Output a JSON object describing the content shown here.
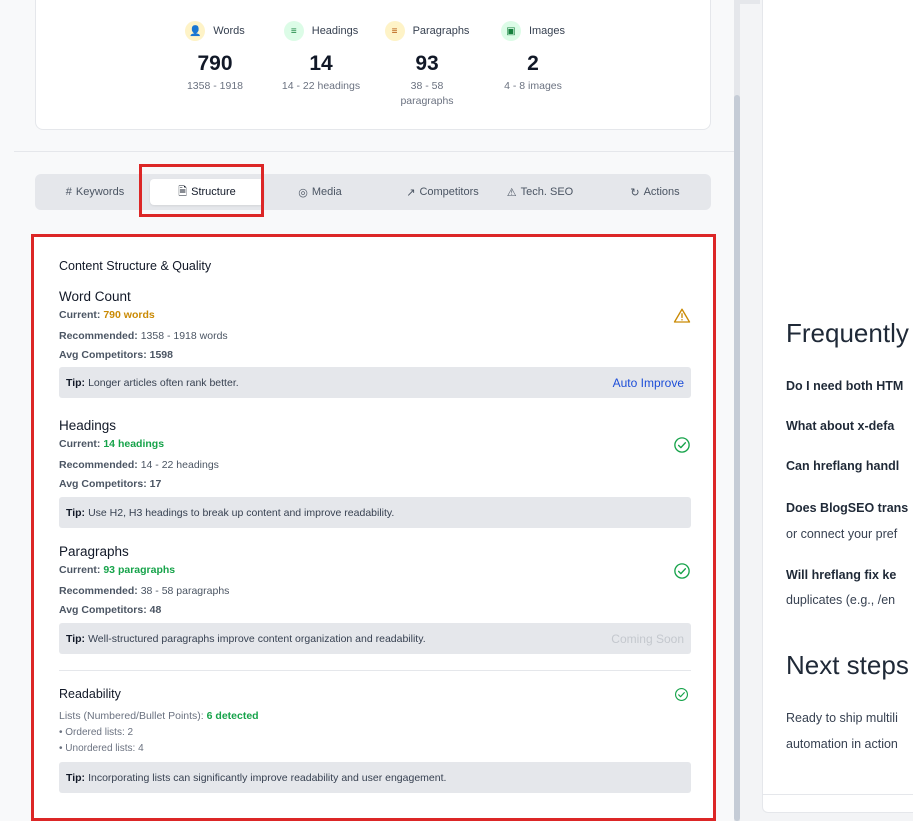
{
  "stats": [
    {
      "label": "Words",
      "value": "790",
      "range": "1358 - 1918",
      "icon": "person-icon"
    },
    {
      "label": "Headings",
      "value": "14",
      "range": "14 - 22 headings",
      "icon": "list-icon"
    },
    {
      "label": "Paragraphs",
      "value": "93",
      "range": "38 - 58 paragraphs",
      "icon": "paragraph-icon"
    },
    {
      "label": "Images",
      "value": "2",
      "range": "4 - 8 images",
      "icon": "image-icon"
    }
  ],
  "tabs": [
    {
      "label": "Keywords",
      "glyph": "#"
    },
    {
      "label": "Structure",
      "glyph": "🗎"
    },
    {
      "label": "Media",
      "glyph": "◎"
    },
    {
      "label": "Competitors",
      "glyph": "↗"
    },
    {
      "label": "Tech. SEO",
      "glyph": "⚠"
    },
    {
      "label": "Actions",
      "glyph": "↻"
    }
  ],
  "section_title": "Content Structure & Quality",
  "word_count": {
    "title": "Word Count",
    "current_label": "Current:",
    "current_value": "790 words",
    "recommended_label": "Recommended:",
    "recommended_value": "1358 - 1918 words",
    "avg_label": "Avg Competitors:",
    "avg_value": "1598",
    "tip_label": "Tip:",
    "tip_text": "Longer articles often rank better.",
    "action": "Auto Improve"
  },
  "headings": {
    "title": "Headings",
    "current_label": "Current:",
    "current_value": "14 headings",
    "recommended_label": "Recommended:",
    "recommended_value": "14 - 22 headings",
    "avg_label": "Avg Competitors:",
    "avg_value": "17",
    "tip_label": "Tip:",
    "tip_text": "Use H2, H3 headings to break up content and improve readability."
  },
  "paragraphs": {
    "title": "Paragraphs",
    "current_label": "Current:",
    "current_value": "93 paragraphs",
    "recommended_label": "Recommended:",
    "recommended_value": "38 - 58 paragraphs",
    "avg_label": "Avg Competitors:",
    "avg_value": "48",
    "tip_label": "Tip:",
    "tip_text": "Well-structured paragraphs improve content organization and readability.",
    "action": "Coming Soon"
  },
  "readability": {
    "title": "Readability",
    "lists_label": "Lists (Numbered/Bullet Points):",
    "lists_value": "6 detected",
    "ordered": "• Ordered lists: 2",
    "unordered": "• Unordered lists: 4",
    "tip_label": "Tip:",
    "tip_text": "Incorporating lists can significantly improve readability and user engagement."
  },
  "article": {
    "faq_heading": "Frequently",
    "q1": "Do I need both HTM",
    "q2": "What about x-defa",
    "q3": "Can hreflang handl",
    "q4": "Does BlogSEO trans",
    "q4_cont": "or connect your pref",
    "q5": "Will hreflang fix ke",
    "q5_cont": "duplicates (e.g., /en",
    "next_heading": "Next steps",
    "p1": "Ready to ship multili",
    "p2": "automation in action"
  },
  "colors": {
    "highlight": "#dc2626",
    "amber": "#ca8a04",
    "green": "#16a34a",
    "link": "#1d4ed8"
  }
}
